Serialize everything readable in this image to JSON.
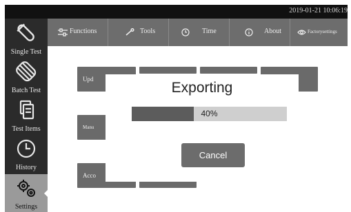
{
  "status_bar": {
    "datetime": "2019-01-21 10:06:19"
  },
  "sidebar": {
    "items": [
      {
        "label": "Single Test",
        "icon": "test-tube-icon",
        "active": false
      },
      {
        "label": "Batch Test",
        "icon": "multiple-test-tubes-icon",
        "active": false
      },
      {
        "label": "Test Items",
        "icon": "documents-icon",
        "active": false
      },
      {
        "label": "History",
        "icon": "clock-icon",
        "active": false
      },
      {
        "label": "Settings",
        "icon": "gears-icon",
        "active": true
      }
    ]
  },
  "menu": {
    "items": [
      {
        "label": "Functions",
        "icon": "sliders-icon"
      },
      {
        "label": "Tools",
        "icon": "wrench-icon"
      },
      {
        "label": "Time",
        "icon": "clock-icon"
      },
      {
        "label": "About",
        "icon": "info-icon"
      },
      {
        "label": "Factorysettings",
        "icon": "eye-icon"
      }
    ]
  },
  "content": {
    "buttons": [
      {
        "label": "Upd"
      },
      {
        "label": "Manu"
      },
      {
        "label": "Acco"
      }
    ]
  },
  "dialog": {
    "title": "Exporting",
    "progress_text": "40%",
    "progress_fraction": 0.4,
    "cancel_label": "Cancel"
  },
  "colors": {
    "sidebar_bg": "#2b2b2b",
    "menubar_bg": "#6d6d6d",
    "button_bg": "#6a6a6a",
    "progress_fill": "#5c5c5c",
    "progress_track": "#cfcfcf"
  }
}
